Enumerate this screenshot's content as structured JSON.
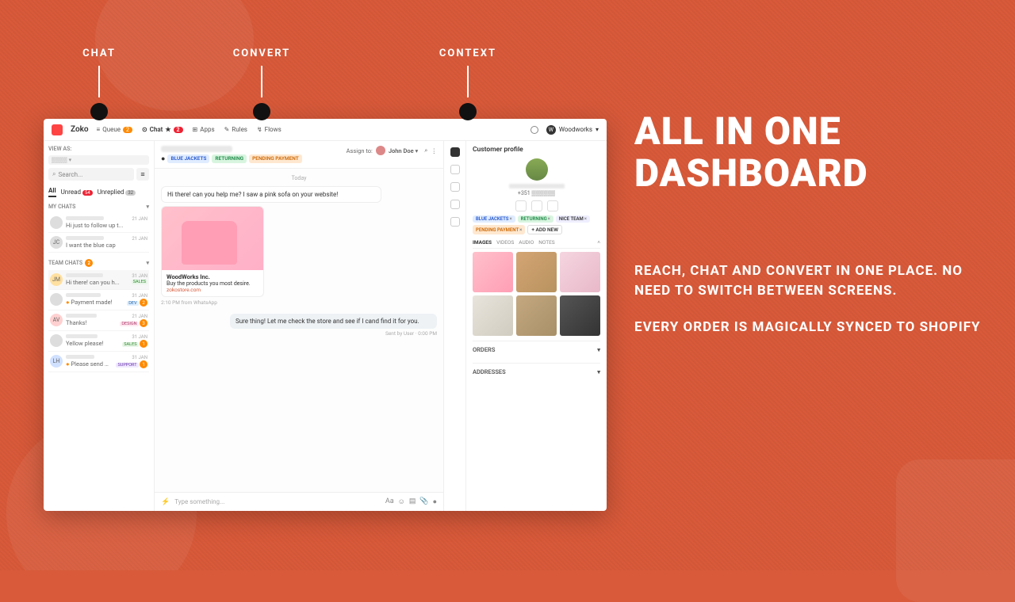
{
  "marketing": {
    "callouts": [
      "CHAT",
      "CONVERT",
      "CONTEXT"
    ],
    "headline": "ALL IN ONE DASHBOARD",
    "sub1": "REACH, CHAT AND CONVERT IN ONE PLACE. NO NEED TO SWITCH BETWEEN SCREENS.",
    "sub2": "EVERY ORDER IS MAGICALLY SYNCED TO SHOPIFY"
  },
  "app": {
    "brand": "Zoko",
    "topnav": {
      "queue": "Queue",
      "queue_count": "2",
      "chat": "Chat",
      "chat_count": "2",
      "apps": "Apps",
      "rules": "Rules",
      "flows": "Flows"
    },
    "account": "Woodworks"
  },
  "sidebar": {
    "viewas": "VIEW AS:",
    "search_placeholder": "Search...",
    "tabs": {
      "all": "All",
      "unread": "Unread",
      "unread_count": "54",
      "unreplied": "Unreplied",
      "unreplied_count": "32"
    },
    "mychats": "MY CHATS",
    "teamchats": "TEAM CHATS",
    "teamchats_count": "2",
    "items": [
      {
        "msg": "Hi just to follow up t...",
        "date": "21 JAN"
      },
      {
        "msg": "I want the blue cap",
        "date": "21 JAN",
        "initials": "JC"
      },
      {
        "msg": "Hi there! can you h...",
        "date": "31 JAN",
        "initials": "JM"
      },
      {
        "msg": "Payment made!",
        "date": "31 JAN",
        "tag": "DEV",
        "count": "2"
      },
      {
        "msg": "Thanks!",
        "date": "21 JAN",
        "initials": "AV",
        "tag": "DESIGN",
        "count": "3"
      },
      {
        "msg": "Yellow please!",
        "date": "31 JAN",
        "tag": "SALES",
        "count": "1"
      },
      {
        "msg": "Please send me t...",
        "date": "31 JAN",
        "tag": "SUPPORT",
        "count": "1"
      }
    ]
  },
  "thread": {
    "tags": [
      "BLUE JACKETS",
      "RETURNING",
      "PENDING PAYMENT"
    ],
    "assign_label": "Assign to:",
    "assign_name": "John Doe",
    "day": "Today",
    "msg_in": "Hi there! can you help me? I saw a pink sofa on your website!",
    "card_title": "WoodWorks Inc.",
    "card_sub": "Buy the products you most desire.",
    "card_link": "zokostore.com",
    "timestamp": "2:10 PM from WhatsApp",
    "msg_out": "Sure thing! Let me check the store and see if I cand find it for you.",
    "sent_by": "Sent by User · 0:00 PM",
    "composer_placeholder": "Type something..."
  },
  "profile": {
    "title": "Customer profile",
    "phone_prefix": "+351",
    "tags": [
      "BLUE JACKETS",
      "RETURNING",
      "NICE TEAM",
      "PENDING PAYMENT"
    ],
    "add_new": "+ ADD NEW",
    "media_tabs": [
      "IMAGES",
      "VIDEOS",
      "AUDIO",
      "NOTES"
    ],
    "orders": "ORDERS",
    "addresses": "ADDRESSES"
  }
}
